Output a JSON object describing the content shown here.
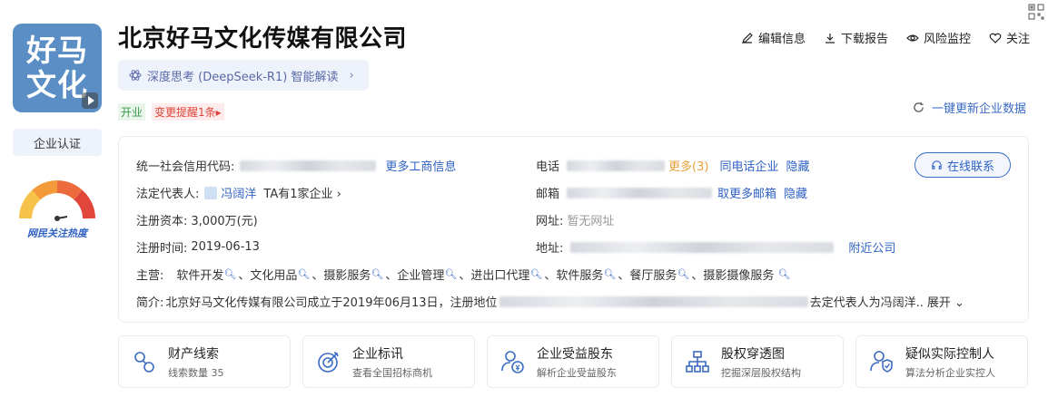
{
  "company": {
    "name": "北京好马文化传媒有限公司",
    "logo_line1": "好马",
    "logo_line2": "文化",
    "ai_pill_label": "深度思考 (DeepSeek-R1) 智能解读",
    "status_tag": "开业",
    "change_tag": "变更提醒1条"
  },
  "sidebar": {
    "cert_label": "企业认证",
    "heat_label": "网民关注热度"
  },
  "actions": [
    {
      "label": "编辑信息",
      "icon": "pencil-icon"
    },
    {
      "label": "下载报告",
      "icon": "download-icon"
    },
    {
      "label": "风险监控",
      "icon": "eye-icon"
    },
    {
      "label": "关注",
      "icon": "heart-icon"
    }
  ],
  "refresh_label": "一键更新企业数据",
  "info": {
    "credit_code_label": "统一社会信用代码:",
    "more_business_info": "更多工商信息",
    "legal_rep_label": "法定代表人:",
    "legal_rep_name": "冯阔洋",
    "legal_rep_companies": "TA有1家企业",
    "capital_label": "注册资本:",
    "capital_value": "3,000万(元)",
    "reg_time_label": "注册时间:",
    "reg_time_value": "2019-06-13",
    "phone_label": "电话",
    "phone_more": "更多(3)",
    "phone_same": "同电话企业",
    "phone_hide": "隐藏",
    "email_label": "邮箱",
    "email_more": "取更多邮箱",
    "email_hide": "隐藏",
    "website_label": "网址:",
    "website_value": "暂无网址",
    "address_label": "地址:",
    "address_nearby": "附近公司",
    "online_contact": "在线联系",
    "business_label": "主营:",
    "business_items": [
      "软件开发",
      "文化用品",
      "摄影服务",
      "企业管理",
      "进出口代理",
      "软件服务",
      "餐厅服务",
      "摄影摄像服务"
    ],
    "intro_label": "简介:",
    "intro_start": "北京好马文化传媒有限公司成立于2019年06月13日，注册地位",
    "intro_end": "去定代表人为冯阔洋..",
    "intro_expand": "展开"
  },
  "features": [
    {
      "title": "财产线索",
      "sub": "线索数量 35",
      "icon": "property-clue-icon"
    },
    {
      "title": "企业标讯",
      "sub": "查看全国招标商机",
      "icon": "target-icon"
    },
    {
      "title": "企业受益股东",
      "sub": "解析企业受益股东",
      "icon": "shareholder-icon"
    },
    {
      "title": "股权穿透图",
      "sub": "挖掘深层股权结构",
      "icon": "org-chart-icon"
    },
    {
      "title": "疑似实际控制人",
      "sub": "算法分析企业实控人",
      "icon": "controller-icon"
    }
  ],
  "colors": {
    "accent_blue": "#2f61c4",
    "logo_bg": "#5b8ec4",
    "status_green": "#3a9a4a",
    "alert_red": "#e0443a"
  }
}
